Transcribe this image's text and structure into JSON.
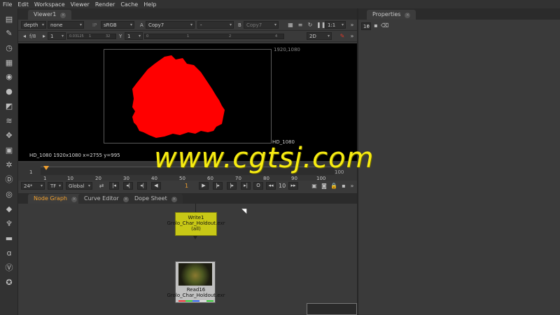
{
  "menu": [
    "File",
    "Edit",
    "Workspace",
    "Viewer",
    "Render",
    "Cache",
    "Help"
  ],
  "viewer": {
    "tab_label": "Viewer1",
    "channels": "depth",
    "channel_sub": "none",
    "ip_label": "IP",
    "colorspace": "sRGB",
    "a_label": "A",
    "a_input": "Copy7",
    "wipe": "-",
    "b_label": "B",
    "b_input": "Copy7",
    "zoom": "1:1",
    "fstop": "f/8",
    "gain_value": "1",
    "gain_ticks": [
      "0.03125",
      "1",
      "32"
    ],
    "y_label": "Y",
    "gamma_value": "1",
    "gamma_ticks": [
      "0",
      "1",
      "2",
      "4"
    ],
    "view_mode": "2D",
    "frame_size_label": "1920,1080",
    "format_label": "HD_1080",
    "status_line": "HD_1080 1920x1080   x=2755 y=995"
  },
  "timeline": {
    "ticks": [
      "1",
      "10",
      "20",
      "30",
      "40",
      "50",
      "60",
      "70",
      "80",
      "90",
      "100"
    ],
    "start_frame": "1",
    "end_frame": "100",
    "fps": "24*",
    "tf": "TF",
    "range_mode": "Global",
    "current_frame": "1",
    "step": "10"
  },
  "node_graph": {
    "tabs": [
      "Node Graph",
      "Curve Editor",
      "Dope Sheet"
    ],
    "write_node": {
      "name": "Write1",
      "file": "Grolo_Char_Holdout.exr",
      "channels": "(all)",
      "color": "#c8c816"
    },
    "read_node": {
      "name": "Read16",
      "file": "Grolo_Char_Holdout.exr"
    }
  },
  "properties": {
    "tab_label": "Properties",
    "max_panels": "10"
  },
  "watermark": "www.cgtsj.com",
  "colors": {
    "matte": "#ff0000",
    "accent": "#f7ec12",
    "active_tab": "#f0a030"
  }
}
